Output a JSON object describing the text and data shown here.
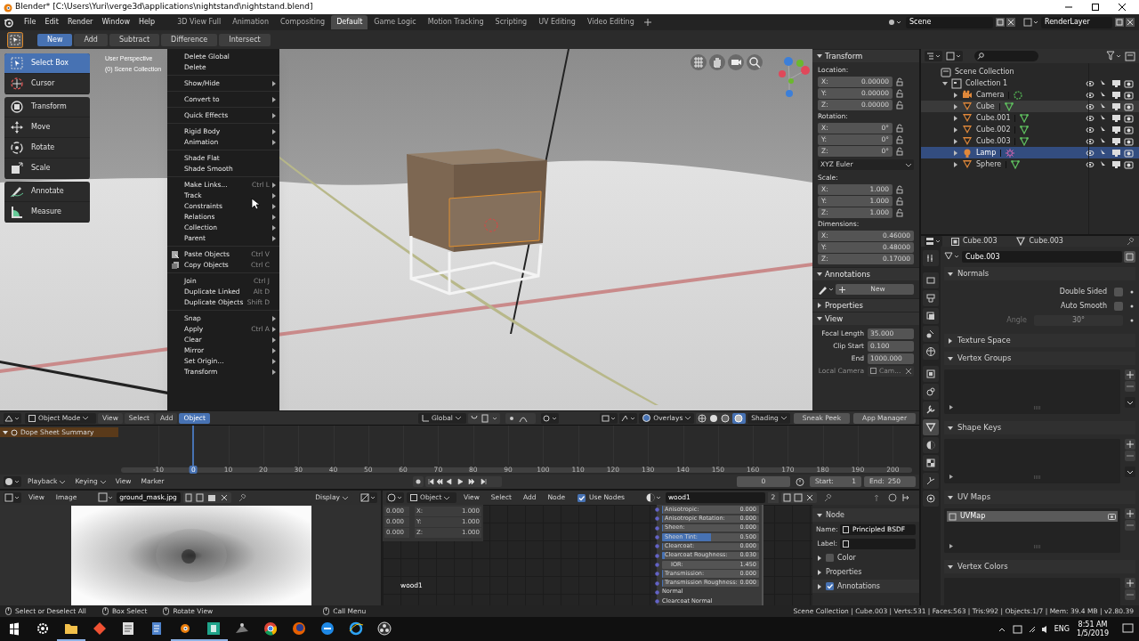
{
  "title_bar": {
    "title": "Blender* [C:\\Users\\Yuri\\verge3d\\applications\\nightstand\\nightstand.blend]"
  },
  "menu": [
    "File",
    "Edit",
    "Render",
    "Window",
    "Help"
  ],
  "workspaces": [
    {
      "label": "3D View Full",
      "selected": false
    },
    {
      "label": "Animation",
      "selected": false
    },
    {
      "label": "Compositing",
      "selected": false
    },
    {
      "label": "Default",
      "selected": true
    },
    {
      "label": "Game Logic",
      "selected": false
    },
    {
      "label": "Motion Tracking",
      "selected": false
    },
    {
      "label": "Scripting",
      "selected": false
    },
    {
      "label": "UV Editing",
      "selected": false
    },
    {
      "label": "Video Editing",
      "selected": false
    }
  ],
  "scene": "Scene",
  "view_layer": "RenderLayer",
  "tool_header": [
    {
      "label": "New",
      "selected": true
    },
    {
      "label": "Add",
      "selected": false
    },
    {
      "label": "Subtract",
      "selected": false
    },
    {
      "label": "Difference",
      "selected": false
    },
    {
      "label": "Intersect",
      "selected": false
    }
  ],
  "viewport": {
    "overlay_text": [
      "User Perspective",
      "(0) Scene Collection"
    ],
    "toolbar": [
      {
        "tools": [
          {
            "label": "Select Box",
            "kind": "select",
            "selected": true
          },
          {
            "label": "Cursor",
            "kind": "cursor",
            "selected": false
          }
        ]
      },
      {
        "tools": [
          {
            "label": "Transform",
            "kind": "transform",
            "selected": false
          },
          {
            "label": "Move",
            "kind": "move",
            "selected": false
          },
          {
            "label": "Rotate",
            "kind": "rotate",
            "selected": false
          },
          {
            "label": "Scale",
            "kind": "scale",
            "selected": false
          }
        ]
      },
      {
        "tools": [
          {
            "label": "Annotate",
            "kind": "annotate",
            "selected": false
          },
          {
            "label": "Measure",
            "kind": "measure",
            "selected": false
          }
        ]
      }
    ],
    "context_menu": [
      [
        {
          "label": "Delete Global",
          "kind": "plain",
          "submenu": false
        },
        {
          "label": "Delete",
          "kind": "plain",
          "submenu": false
        }
      ],
      [
        {
          "label": "Show/Hide",
          "kind": "plain",
          "submenu": true
        }
      ],
      [
        {
          "label": "Convert to",
          "kind": "plain",
          "submenu": true
        }
      ],
      [
        {
          "label": "Quick Effects",
          "kind": "plain",
          "submenu": true
        }
      ],
      [
        {
          "label": "Rigid Body",
          "kind": "plain",
          "submenu": true
        },
        {
          "label": "Animation",
          "kind": "plain",
          "submenu": true
        }
      ],
      [
        {
          "label": "Shade Flat",
          "kind": "plain",
          "submenu": false
        },
        {
          "label": "Shade Smooth",
          "kind": "plain",
          "submenu": false
        }
      ],
      [
        {
          "label": "Make Links...",
          "kind": "plain",
          "shortcut": "Ctrl L",
          "submenu": true
        },
        {
          "label": "Track",
          "kind": "plain",
          "submenu": true
        },
        {
          "label": "Constraints",
          "kind": "plain",
          "submenu": true
        },
        {
          "label": "Relations",
          "kind": "plain",
          "submenu": true
        },
        {
          "label": "Collection",
          "kind": "plain",
          "submenu": true
        },
        {
          "label": "Parent",
          "kind": "plain",
          "submenu": true
        }
      ],
      [
        {
          "label": "Paste Objects",
          "kind": "paste",
          "shortcut": "Ctrl V",
          "submenu": false
        },
        {
          "label": "Copy Objects",
          "kind": "copy",
          "shortcut": "Ctrl C",
          "submenu": false
        }
      ],
      [
        {
          "label": "Join",
          "kind": "plain",
          "shortcut": "Ctrl J",
          "submenu": false
        },
        {
          "label": "Duplicate Linked",
          "kind": "plain",
          "shortcut": "Alt D",
          "submenu": false
        },
        {
          "label": "Duplicate Objects",
          "kind": "plain",
          "shortcut": "Shift D",
          "submenu": false
        }
      ],
      [
        {
          "label": "Snap",
          "kind": "plain",
          "submenu": true
        },
        {
          "label": "Apply",
          "kind": "plain",
          "shortcut": "Ctrl A",
          "submenu": true
        },
        {
          "label": "Clear",
          "kind": "plain",
          "submenu": true
        },
        {
          "label": "Mirror",
          "kind": "plain",
          "submenu": true
        },
        {
          "label": "Set Origin...",
          "kind": "plain",
          "submenu": true
        },
        {
          "label": "Transform",
          "kind": "plain",
          "submenu": true
        }
      ]
    ],
    "header": {
      "mode": "Object Mode",
      "menus": [
        {
          "label": "View",
          "selected": false
        },
        {
          "label": "Select",
          "selected": false
        },
        {
          "label": "Add",
          "selected": false
        },
        {
          "label": "Object",
          "selected": true
        }
      ],
      "orientation": "Global",
      "overlays": "Overlays",
      "shading": "Shading",
      "buttons": [
        "Sneak Peek",
        "App Manager"
      ]
    }
  },
  "n_panel": [
    {
      "title": "Transform",
      "expanded": true,
      "rows": [
        {
          "kind": "label",
          "text": "Location:"
        },
        {
          "kind": "vector",
          "axis": "X:",
          "value": "0.00000",
          "lockable": true
        },
        {
          "kind": "vector",
          "axis": "Y:",
          "value": "0.00000",
          "lockable": true
        },
        {
          "kind": "vector",
          "axis": "Z:",
          "value": "0.00000",
          "lockable": true
        },
        {
          "kind": "label",
          "text": "Rotation:"
        },
        {
          "kind": "vector",
          "axis": "X:",
          "value": "0°",
          "lockable": true
        },
        {
          "kind": "vector",
          "axis": "Y:",
          "value": "0°",
          "lockable": true
        },
        {
          "kind": "vector",
          "axis": "Z:",
          "value": "0°",
          "lockable": true
        },
        {
          "kind": "dropdown",
          "value": "XYZ Euler"
        },
        {
          "kind": "label",
          "text": "Scale:"
        },
        {
          "kind": "vector",
          "axis": "X:",
          "value": "1.000",
          "lockable": true
        },
        {
          "kind": "vector",
          "axis": "Y:",
          "value": "1.000",
          "lockable": true
        },
        {
          "kind": "vector",
          "axis": "Z:",
          "value": "1.000",
          "lockable": true
        },
        {
          "kind": "label",
          "text": "Dimensions:"
        },
        {
          "kind": "vector",
          "axis": "X:",
          "value": "0.46000",
          "lockable": false
        },
        {
          "kind": "vector",
          "axis": "Y:",
          "value": "0.48000",
          "lockable": false
        },
        {
          "kind": "vector",
          "axis": "Z:",
          "value": "0.17000",
          "lockable": false
        }
      ]
    },
    {
      "title": "Annotations",
      "expanded": true,
      "rows": [
        {
          "kind": "new",
          "value": "New"
        }
      ]
    },
    {
      "title": "Properties",
      "expanded": false
    },
    {
      "title": "View",
      "expanded": true,
      "rows": [
        {
          "kind": "prop",
          "label": "Focal Length",
          "value": "35.000"
        },
        {
          "kind": "prop",
          "label": "Clip Start",
          "value": "0.100"
        },
        {
          "kind": "prop",
          "label": "End",
          "value": "1000.000"
        },
        {
          "kind": "camera",
          "label": "Local Camera",
          "value": "Cam..."
        }
      ]
    }
  ],
  "outliner": {
    "tree": [
      {
        "label": "Scene Collection",
        "kind": "scene",
        "children": [
          {
            "label": "Collection 1",
            "kind": "collection",
            "expanded": true,
            "selected": false,
            "highlighted": false,
            "children": [
              {
                "label": "Camera",
                "kind": "camera",
                "expanded": false,
                "selected": false,
                "highlighted": false
              },
              {
                "label": "Cube",
                "kind": "mesh",
                "expanded": false,
                "selected": false,
                "highlighted": true
              },
              {
                "label": "Cube.001",
                "kind": "mesh",
                "expanded": false,
                "selected": false,
                "highlighted": false
              },
              {
                "label": "Cube.002",
                "kind": "mesh",
                "expanded": false,
                "selected": false,
                "highlighted": false
              },
              {
                "label": "Cube.003",
                "kind": "mesh",
                "expanded": false,
                "selected": false,
                "highlighted": false
              },
              {
                "label": "Lamp",
                "kind": "lamp",
                "expanded": false,
                "selected": true,
                "highlighted": false
              },
              {
                "label": "Sphere",
                "kind": "mesh",
                "expanded": false,
                "selected": false,
                "highlighted": false
              }
            ]
          }
        ]
      }
    ]
  },
  "properties": {
    "object": "Cube.003",
    "data": "Cube.003",
    "datablock": "Cube.003",
    "tabs": [
      {
        "kind": "tool",
        "selected": false
      },
      {
        "kind": "render",
        "selected": false
      },
      {
        "kind": "output",
        "selected": false
      },
      {
        "kind": "layer",
        "selected": false
      },
      {
        "kind": "scene",
        "selected": false
      },
      {
        "kind": "world",
        "selected": false
      },
      {
        "kind": "object",
        "selected": false
      },
      {
        "kind": "constraint",
        "selected": false
      },
      {
        "kind": "modifier",
        "selected": false
      },
      {
        "kind": "mesh",
        "selected": true
      },
      {
        "kind": "material",
        "selected": false
      },
      {
        "kind": "texture",
        "selected": false
      },
      {
        "kind": "particles",
        "selected": false
      },
      {
        "kind": "physics",
        "selected": false
      }
    ],
    "panels": [
      {
        "title": "Normals",
        "expanded": true,
        "kind": "settings",
        "rows": [
          {
            "kind": "check",
            "label": "Double Sided",
            "checked": false
          },
          {
            "kind": "check",
            "label": "Auto Smooth",
            "checked": false
          },
          {
            "kind": "value",
            "label": "Angle",
            "value": "30°",
            "disabled": true
          }
        ]
      },
      {
        "title": "Texture Space",
        "expanded": false
      },
      {
        "title": "Vertex Groups",
        "expanded": true,
        "kind": "list",
        "specials": true
      },
      {
        "title": "Shape Keys",
        "expanded": true,
        "kind": "list",
        "specials": true
      },
      {
        "title": "UV Maps",
        "expanded": true,
        "kind": "list",
        "specials": false,
        "items": [
          {
            "label": "UVMap",
            "selected": true
          }
        ]
      },
      {
        "title": "Vertex Colors",
        "expanded": true,
        "kind": "list",
        "specials": false
      }
    ]
  },
  "timeline": {
    "channel": "Dope Sheet Summary",
    "frames": [
      {
        "label": "-10",
        "selected": false
      },
      {
        "label": "0",
        "selected": true
      },
      {
        "label": "10",
        "selected": false
      },
      {
        "label": "20",
        "selected": false
      },
      {
        "label": "30",
        "selected": false
      },
      {
        "label": "40",
        "selected": false
      },
      {
        "label": "50",
        "selected": false
      },
      {
        "label": "60",
        "selected": false
      },
      {
        "label": "70",
        "selected": false
      },
      {
        "label": "80",
        "selected": false
      },
      {
        "label": "90",
        "selected": false
      },
      {
        "label": "100",
        "selected": false
      },
      {
        "label": "110",
        "selected": false
      },
      {
        "label": "120",
        "selected": false
      },
      {
        "label": "130",
        "selected": false
      },
      {
        "label": "140",
        "selected": false
      },
      {
        "label": "150",
        "selected": false
      },
      {
        "label": "160",
        "selected": false
      },
      {
        "label": "170",
        "selected": false
      },
      {
        "label": "180",
        "selected": false
      },
      {
        "label": "190",
        "selected": false
      },
      {
        "label": "200",
        "selected": false
      }
    ],
    "menus": [
      "Playback",
      "Keying"
    ],
    "plain_menus": [
      "View",
      "Marker"
    ],
    "current": "0",
    "start_label": "Start:",
    "start": "1",
    "end_label": "End:",
    "end": "250"
  },
  "image_editor": {
    "menus": [
      "View",
      "Image"
    ],
    "image": "ground_mask.jpg",
    "display": "Display"
  },
  "node_editor": {
    "type": "Object",
    "menus": [
      "View",
      "Select",
      "Add",
      "Node"
    ],
    "use_nodes": {
      "label": "Use Nodes",
      "checked": true
    },
    "material": "wood1",
    "users": "2",
    "vector_rows": [
      {
        "value": "0.000",
        "axis": "X:",
        "scale": "1.000"
      },
      {
        "value": "0.000",
        "axis": "Y:",
        "scale": "1.000"
      },
      {
        "value": "0.000",
        "axis": "Z:",
        "scale": "1.000"
      }
    ],
    "frame_label": "wood1",
    "node_rows": [
      {
        "kind": "slider",
        "label": "Anisotropic:",
        "value": "0.000",
        "level": 0
      },
      {
        "kind": "slider",
        "label": "Anisotropic Rotation:",
        "value": "0.000",
        "level": 0
      },
      {
        "kind": "slider",
        "label": "Sheen:",
        "value": "0.000",
        "level": 0
      },
      {
        "kind": "slider",
        "label": "Sheen Tint:",
        "value": "0.500",
        "level": 0.5
      },
      {
        "kind": "slider",
        "label": "Clearcoat:",
        "value": "0.000",
        "level": 0
      },
      {
        "kind": "slider",
        "label": "Clearcoat Roughness:",
        "value": "0.030",
        "level": 0.03
      },
      {
        "kind": "field",
        "label": "IOR:",
        "value": "1.450"
      },
      {
        "kind": "slider",
        "label": "Transmission:",
        "value": "0.000",
        "level": 0
      },
      {
        "kind": "slider",
        "label": "Transmission Roughness:",
        "value": "0.000",
        "level": 0
      },
      {
        "kind": "socket",
        "label": "Normal"
      },
      {
        "kind": "socket",
        "label": "Clearcoat Normal"
      }
    ],
    "sidebar": {
      "title": "Node",
      "name_label": "Name:",
      "name": "Principled BSDF",
      "label_label": "Label:",
      "sections": [
        {
          "label": "Color",
          "kind": "check",
          "checked": false
        },
        {
          "label": "Properties",
          "kind": "plain"
        },
        {
          "label": "Annotations",
          "kind": "check",
          "checked": true
        }
      ]
    }
  },
  "status_bar": {
    "hints": [
      "Select or Deselect All",
      "Box Select",
      "Rotate View",
      "Call Menu"
    ],
    "stats": "Scene Collection | Cube.003 | Verts:531 | Faces:563 | Tris:992 | Objects:1/7 | Mem: 39.4 MB | v2.80.39"
  },
  "taskbar": {
    "apps": [
      {
        "kind": "settings",
        "open": false
      },
      {
        "kind": "folder",
        "open": true
      },
      {
        "kind": "git",
        "open": false
      },
      {
        "kind": "notepad",
        "open": false
      },
      {
        "kind": "document",
        "open": false
      },
      {
        "kind": "blender",
        "open": true
      },
      {
        "kind": "three",
        "open": true
      },
      {
        "kind": "tool",
        "open": false
      },
      {
        "kind": "chrome",
        "open": false
      },
      {
        "kind": "firefox",
        "open": false
      },
      {
        "kind": "edge",
        "open": false
      },
      {
        "kind": "ie",
        "open": false
      },
      {
        "kind": "obs",
        "open": false
      }
    ],
    "language": "ENG",
    "time": "8:51 AM",
    "date": "1/5/2019"
  }
}
